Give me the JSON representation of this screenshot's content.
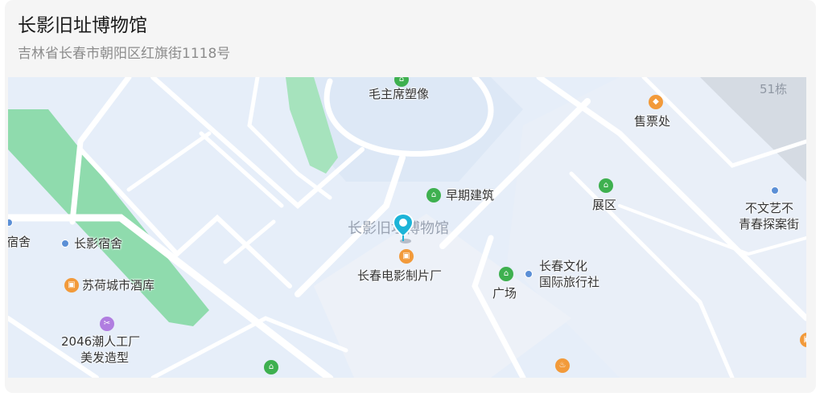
{
  "header": {
    "title": "长影旧址博物馆",
    "address": "吉林省长春市朝阳区红旗街1118号"
  },
  "map": {
    "pois": [
      {
        "name": "毛主席塑像",
        "icon": "park-icon",
        "color": "#3eb04f"
      },
      {
        "name": "售票处",
        "icon": "ticket-icon",
        "color": "#f29a3a"
      },
      {
        "name": "51栋",
        "icon": "",
        "color": "#8f97a3"
      },
      {
        "name": "早期建筑",
        "icon": "park-icon",
        "color": "#3eb04f"
      },
      {
        "name": "展区",
        "icon": "park-icon",
        "color": "#3eb04f"
      },
      {
        "name": "不文艺不",
        "icon": "dot-icon",
        "color": "#5b8fd6"
      },
      {
        "name": "青春探案街",
        "icon": "",
        "color": "#333333"
      },
      {
        "name": "长影旧址博物馆",
        "icon": "location-pin-icon",
        "color": "#1db4d8"
      },
      {
        "name": "长春电影制片厂",
        "icon": "shopping-icon",
        "color": "#f29a3a"
      },
      {
        "name": "长春文化",
        "icon": "dot-icon",
        "color": "#5b8fd6"
      },
      {
        "name": "国际旅行社",
        "icon": "",
        "color": "#333333"
      },
      {
        "name": "广场",
        "icon": "park-icon",
        "color": "#3eb04f"
      },
      {
        "name": "宿舍",
        "icon": "dot-icon",
        "color": "#5b8fd6"
      },
      {
        "name": "长影宿舍",
        "icon": "dot-icon",
        "color": "#5b8fd6"
      },
      {
        "name": "苏荷城市酒库",
        "icon": "shopping-icon",
        "color": "#f29a3a"
      },
      {
        "name": "2046潮人工厂",
        "icon": "scissors-icon",
        "color": "#b07de0"
      },
      {
        "name": "美发造型",
        "icon": "",
        "color": "#333333"
      }
    ]
  }
}
